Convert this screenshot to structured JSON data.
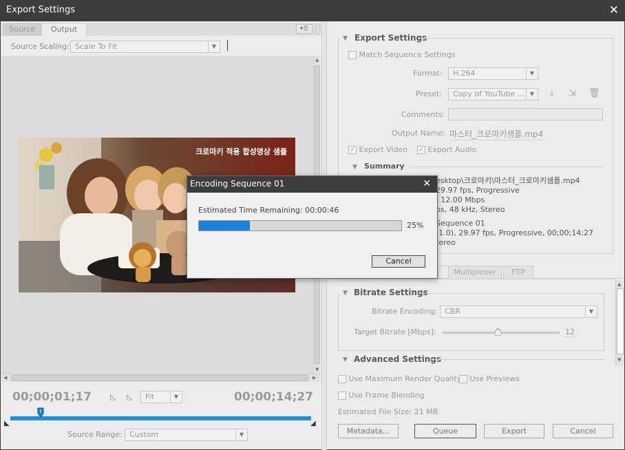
{
  "window": {
    "title": "Export Settings",
    "close": "✕"
  },
  "left": {
    "tabs": [
      "Source",
      "Output"
    ],
    "menu_glyph": "▾☰",
    "source_scaling_label": "Source Scaling:",
    "source_scaling_value": "Scale To Fit",
    "video_caption": "크로마키 적용 합성영상 샘플",
    "timecode_current": "00;00;01;17",
    "timecode_duration": "00;00;14;27",
    "fit_value": "Fit",
    "source_range_label": "Source Range:",
    "source_range_value": "Custom",
    "playhead_position": 0.1
  },
  "export": {
    "section_title": "Export Settings",
    "match_sequence": "Match Sequence Settings",
    "format_label": "Format:",
    "format_value": "H.264",
    "preset_label": "Preset:",
    "preset_value": "Copy of YouTube ...",
    "comments_label": "Comments:",
    "comments_value": "",
    "output_name_label": "Output Name:",
    "output_name_value": "마스터_크로마키샘플.mp4",
    "export_video": "Export Video",
    "export_audio": "Export Audio",
    "summary_title": "Summary",
    "summary_lines_top": [
      "esktop\\크로마키\\마스터_크로마키샘플.mp4",
      "29.97 fps, Progressive",
      ": 12.00 Mbps",
      "ps, 48 kHz, Stereo"
    ],
    "summary_lines_bottom": [
      "Sequence 01",
      "(1.0), 29.97 fps, Progressive, 00;00;14;27",
      "tereo"
    ]
  },
  "tabs2": [
    "Multiplexer",
    "FTP"
  ],
  "bitrate": {
    "section_title": "Bitrate Settings",
    "encoding_label": "Bitrate Encoding:",
    "encoding_value": "CBR",
    "target_label": "Target Bitrate [Mbps]:",
    "target_value": "12",
    "slider_fraction": 0.47
  },
  "advanced": {
    "section_title": "Advanced Settings"
  },
  "bottom": {
    "max_render": "Use Maximum Render Quality",
    "use_previews": "Use Previews",
    "frame_blending": "Use Frame Blending",
    "file_size": "Estimated File Size:  21 MB",
    "buttons": {
      "metadata": "Metadata...",
      "queue": "Queue",
      "export": "Export",
      "cancel": "Cancel"
    }
  },
  "dialog": {
    "title": "Encoding Sequence 01",
    "close": "✕",
    "remaining": "Estimated Time Remaining: 00:00:46",
    "progress": 0.25,
    "progress_text": "25%",
    "cancel": "Cancel"
  },
  "colors": {
    "accent": "#1a82dd",
    "titlebar": "#3c3c3c"
  }
}
